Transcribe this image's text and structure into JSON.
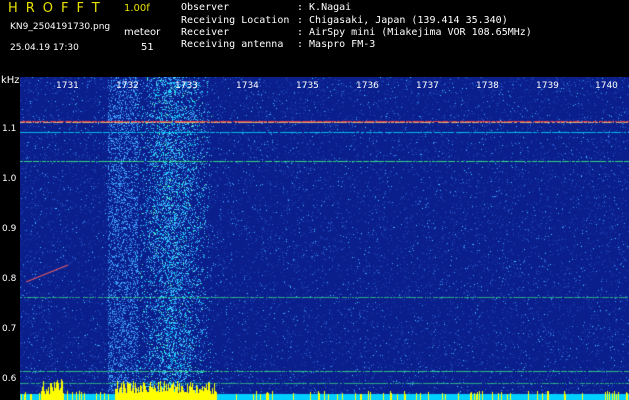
{
  "header": {
    "app_title": "HROFFT",
    "version": "1.00f",
    "filename": "KN9_2504191730.png",
    "mode": "meteor",
    "datetime": "25.04.19 17:30",
    "count": "51",
    "info": [
      {
        "label": "Observer",
        "value": ": K.Nagai"
      },
      {
        "label": "Receiving Location",
        "value": ": Chigasaki, Japan (139.414 35.340)"
      },
      {
        "label": "Receiver",
        "value": ": AirSpy mini (Miakejima VOR 108.65MHz)"
      },
      {
        "label": "Receiving antenna",
        "value": ": Maspro FM-3"
      }
    ]
  },
  "spectrogram": {
    "freq_unit": "kHz",
    "freq_ticks": [
      "1.1",
      "1.0",
      "0.9",
      "0.8",
      "0.7",
      "0.6"
    ],
    "time_ticks": [
      "1731",
      "1732",
      "1733",
      "1734",
      "1735",
      "1736",
      "1737",
      "1738",
      "1739",
      "1740"
    ],
    "colors": {
      "background": "#0a1f8c",
      "signal": "#00e0ff",
      "strong": "#ffff00",
      "carrier": "#ff4040"
    }
  }
}
